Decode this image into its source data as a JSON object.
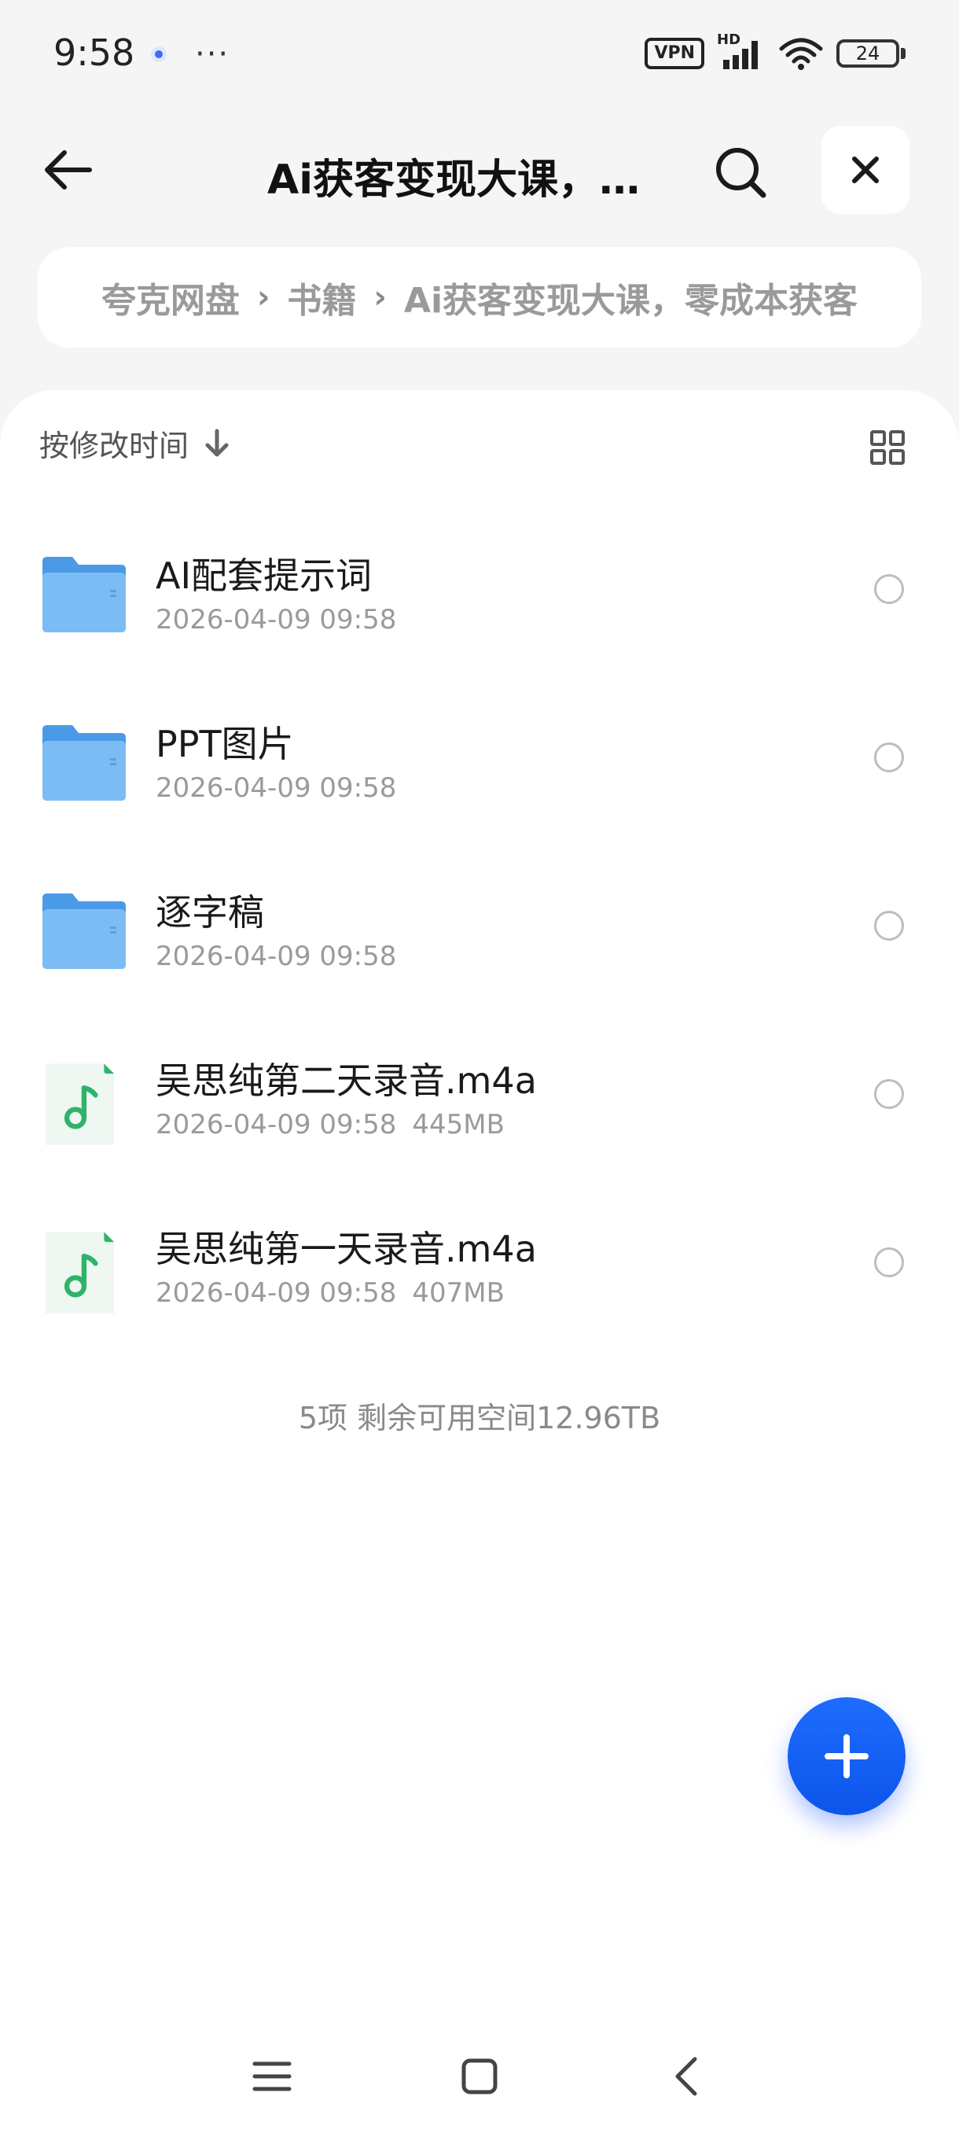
{
  "status_bar": {
    "time": "9:58",
    "dots": "···",
    "vpn": "VPN",
    "hd": "HD",
    "battery": "24"
  },
  "header": {
    "title": "Ai获客变现大课，零成本获客"
  },
  "breadcrumb": {
    "items": [
      "夸克网盘",
      "书籍",
      "Ai获客变现大课，零成本获客"
    ],
    "separator": "›"
  },
  "toolbar": {
    "sort_label": "按修改时间"
  },
  "files": [
    {
      "name": "AI配套提示词",
      "date": "2026-04-09 09:58",
      "size": "",
      "type": "folder"
    },
    {
      "name": "PPT图片",
      "date": "2026-04-09 09:58",
      "size": "",
      "type": "folder"
    },
    {
      "name": "逐字稿",
      "date": "2026-04-09 09:58",
      "size": "",
      "type": "folder"
    },
    {
      "name": "吴思纯第二天录音.m4a",
      "date": "2026-04-09 09:58",
      "size": "445MB",
      "type": "audio"
    },
    {
      "name": "吴思纯第一天录音.m4a",
      "date": "2026-04-09 09:58",
      "size": "407MB",
      "type": "audio"
    }
  ],
  "summary": "5项 剩余可用空间12.96TB",
  "colors": {
    "accent": "#1e6cff",
    "folder": "#5aa8f0",
    "audio": "#2fb36b"
  }
}
